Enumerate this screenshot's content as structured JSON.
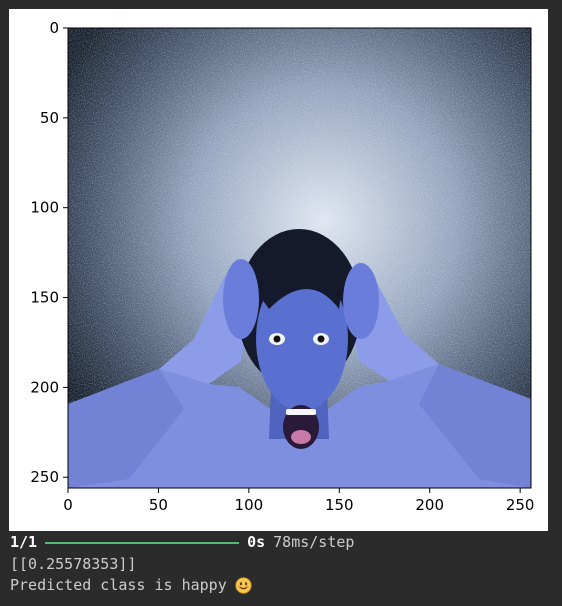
{
  "figure": {
    "image_subject": "surprised person with hands on head, blue tinted",
    "x_ticks": [
      "0",
      "50",
      "100",
      "150",
      "200",
      "250"
    ],
    "y_ticks": [
      "0",
      "50",
      "100",
      "150",
      "200",
      "250"
    ],
    "xlim": [
      0,
      256
    ],
    "ylim": [
      256,
      0
    ]
  },
  "output": {
    "progress": {
      "step_count": "1/1",
      "fraction": 1.0,
      "eta": "0s",
      "step_time": "78ms/step"
    },
    "prediction_array": "[[0.25578353]]",
    "result_text": "Predicted class is happy",
    "result_emoji_icon": "smiling-face-icon"
  },
  "colors": {
    "background": "#2b2b2b",
    "progress_green": "#56b77b"
  }
}
